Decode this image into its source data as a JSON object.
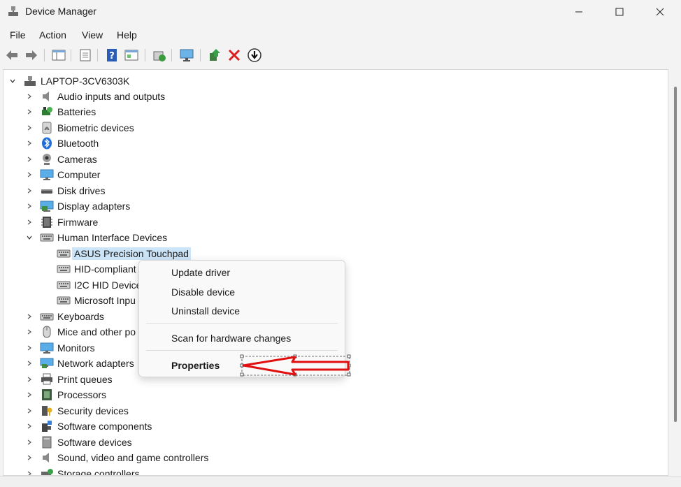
{
  "window": {
    "title": "Device Manager"
  },
  "menu": [
    "File",
    "Action",
    "View",
    "Help"
  ],
  "toolbar": {
    "icons": [
      "back-icon",
      "forward-icon",
      "show-hide-tree-icon",
      "properties-icon",
      "help-icon",
      "view-icon",
      "update-driver-icon",
      "display-scan-icon",
      "enable-device-icon",
      "uninstall-icon",
      "download-icon"
    ]
  },
  "tree": {
    "root": "LAPTOP-3CV6303K",
    "categories": [
      {
        "label": "Audio inputs and outputs",
        "icon": "speaker-icon"
      },
      {
        "label": "Batteries",
        "icon": "battery-icon"
      },
      {
        "label": "Biometric devices",
        "icon": "fingerprint-icon"
      },
      {
        "label": "Bluetooth",
        "icon": "bluetooth-icon"
      },
      {
        "label": "Cameras",
        "icon": "camera-icon"
      },
      {
        "label": "Computer",
        "icon": "monitor-icon"
      },
      {
        "label": "Disk drives",
        "icon": "disk-drive-icon"
      },
      {
        "label": "Display adapters",
        "icon": "display-adapter-icon"
      },
      {
        "label": "Firmware",
        "icon": "chip-icon"
      },
      {
        "label": "Human Interface Devices",
        "icon": "keyboard-hid-icon"
      }
    ],
    "hid_children": [
      {
        "label": "ASUS Precision Touchpad"
      },
      {
        "label": "HID-compliant"
      },
      {
        "label": "I2C HID Device"
      },
      {
        "label": "Microsoft Inpu"
      }
    ],
    "categories_after": [
      {
        "label": "Keyboards",
        "icon": "keyboard-icon"
      },
      {
        "label": "Mice and other po",
        "icon": "mouse-icon"
      },
      {
        "label": "Monitors",
        "icon": "monitor-icon"
      },
      {
        "label": "Network adapters",
        "icon": "network-icon"
      },
      {
        "label": "Print queues",
        "icon": "printer-icon"
      },
      {
        "label": "Processors",
        "icon": "processor-icon"
      },
      {
        "label": "Security devices",
        "icon": "security-key-icon"
      },
      {
        "label": "Software components",
        "icon": "puzzle-icon"
      },
      {
        "label": "Software devices",
        "icon": "device-icon"
      },
      {
        "label": "Sound, video and game controllers",
        "icon": "speaker-icon"
      },
      {
        "label": "Storage controllers",
        "icon": "storage-icon"
      }
    ]
  },
  "context_menu": {
    "items": [
      "Update driver",
      "Disable device",
      "Uninstall device",
      "Scan for hardware changes",
      "Properties"
    ]
  },
  "colors": {
    "selection": "#cce4f7",
    "annotation_arrow": "#e01010"
  }
}
